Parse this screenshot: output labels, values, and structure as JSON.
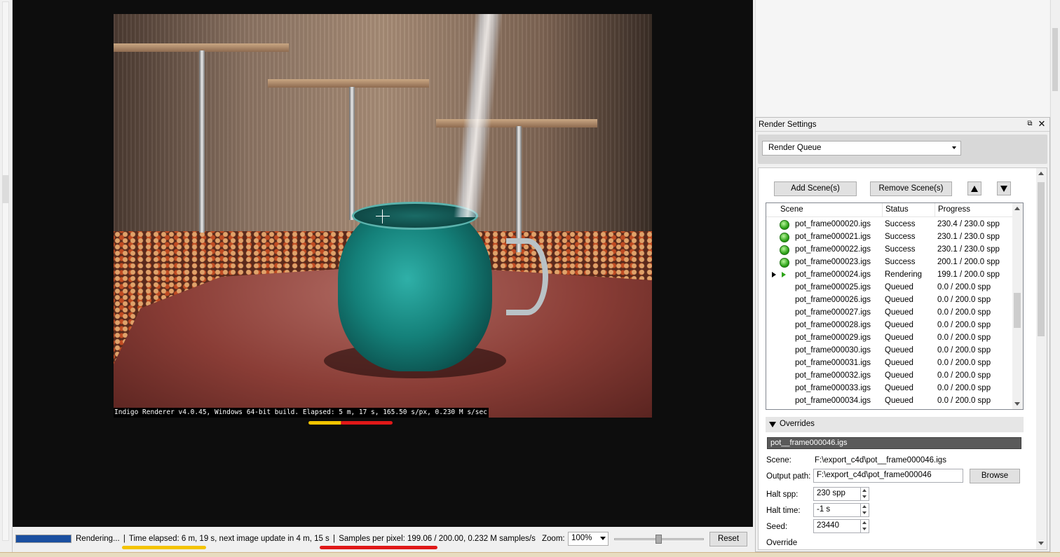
{
  "viewport": {
    "render_caption": "Indigo Renderer v4.0.45, Windows 64-bit build. Elapsed: 5 m, 17 s, 165.50 s/px, 0.230 M s/sec"
  },
  "statusbar": {
    "progress_fraction": 0.995,
    "progress_color": "#1a4fa0",
    "rendering_label": "Rendering...",
    "time_elapsed": "Time elapsed: 6 m, 19 s, next image update in 4 m, 15 s",
    "samples": "Samples per pixel: 199.06 / 200.00, 0.232 M samples/s",
    "zoom_label": "Zoom:",
    "zoom_value": "100%",
    "reset_label": "Reset"
  },
  "panel": {
    "title": "Render Settings",
    "float_icon": "float-window-icon",
    "close_icon": "close-icon",
    "mode": "Render Queue",
    "add_scene_label": "Add Scene(s)",
    "remove_scene_label": "Remove Scene(s)",
    "move_up_icon": "triangle-up-icon",
    "move_down_icon": "triangle-down-icon",
    "queue": {
      "headers": [
        "Scene",
        "Status",
        "Progress"
      ],
      "rows": [
        {
          "scene": "pot_frame000020.igs",
          "status": "Success",
          "progress": "230.4 / 230.0 spp",
          "icon": "success"
        },
        {
          "scene": "pot_frame000021.igs",
          "status": "Success",
          "progress": "230.1 / 230.0 spp",
          "icon": "success"
        },
        {
          "scene": "pot_frame000022.igs",
          "status": "Success",
          "progress": "230.1 / 230.0 spp",
          "icon": "success"
        },
        {
          "scene": "pot_frame000023.igs",
          "status": "Success",
          "progress": "200.1 / 200.0 spp",
          "icon": "success"
        },
        {
          "scene": "pot_frame000024.igs",
          "status": "Rendering",
          "progress": "199.1 / 200.0 spp",
          "icon": "rendering"
        },
        {
          "scene": "pot_frame000025.igs",
          "status": "Queued",
          "progress": "0.0 / 200.0 spp",
          "icon": "none"
        },
        {
          "scene": "pot_frame000026.igs",
          "status": "Queued",
          "progress": "0.0 / 200.0 spp",
          "icon": "none"
        },
        {
          "scene": "pot_frame000027.igs",
          "status": "Queued",
          "progress": "0.0 / 200.0 spp",
          "icon": "none"
        },
        {
          "scene": "pot_frame000028.igs",
          "status": "Queued",
          "progress": "0.0 / 200.0 spp",
          "icon": "none"
        },
        {
          "scene": "pot_frame000029.igs",
          "status": "Queued",
          "progress": "0.0 / 200.0 spp",
          "icon": "none"
        },
        {
          "scene": "pot_frame000030.igs",
          "status": "Queued",
          "progress": "0.0 / 200.0 spp",
          "icon": "none"
        },
        {
          "scene": "pot_frame000031.igs",
          "status": "Queued",
          "progress": "0.0 / 200.0 spp",
          "icon": "none"
        },
        {
          "scene": "pot_frame000032.igs",
          "status": "Queued",
          "progress": "0.0 / 200.0 spp",
          "icon": "none"
        },
        {
          "scene": "pot_frame000033.igs",
          "status": "Queued",
          "progress": "0.0 / 200.0 spp",
          "icon": "none"
        },
        {
          "scene": "pot_frame000034.igs",
          "status": "Queued",
          "progress": "0.0 / 200.0 spp",
          "icon": "none"
        }
      ]
    },
    "overrides": {
      "header": "Overrides",
      "selected_scene": "pot__frame000046.igs",
      "scene_label": "Scene:",
      "scene_value": "F:\\export_c4d\\pot__frame000046.igs",
      "output_label": "Output path:",
      "output_value": "F:\\export_c4d\\pot_frame000046",
      "browse_label": "Browse",
      "halt_spp_label": "Halt spp:",
      "halt_spp_value": "230 spp",
      "halt_time_label": "Halt time:",
      "halt_time_value": "-1 s",
      "seed_label": "Seed:",
      "seed_value": "23440",
      "override_label": "Override"
    }
  },
  "colors": {
    "success_green": "#2fa41a",
    "highlight_yellow": "#f4c400",
    "highlight_red": "#e01818"
  }
}
